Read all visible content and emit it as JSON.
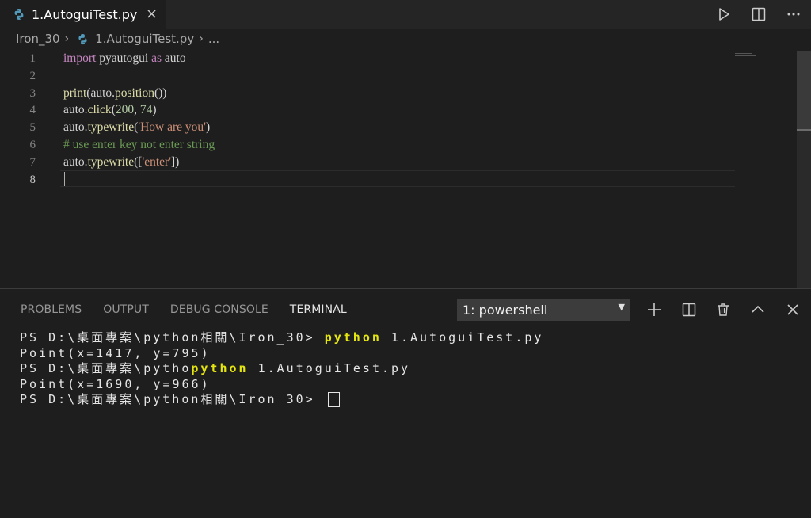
{
  "tab": {
    "label": "1.AutoguiTest.py",
    "close": "×"
  },
  "breadcrumb": {
    "folder": "Iron_30",
    "file": "1.AutoguiTest.py",
    "more": "..."
  },
  "editor": {
    "line_numbers": [
      "1",
      "2",
      "3",
      "4",
      "5",
      "6",
      "7",
      "8"
    ],
    "lines": [
      [
        {
          "t": "import",
          "c": "kw"
        },
        {
          "t": " pyautogui ",
          "c": ""
        },
        {
          "t": "as",
          "c": "kw"
        },
        {
          "t": " auto",
          "c": ""
        }
      ],
      [],
      [
        {
          "t": "print",
          "c": "fn"
        },
        {
          "t": "(auto.",
          "c": ""
        },
        {
          "t": "position",
          "c": "fn"
        },
        {
          "t": "())",
          "c": ""
        }
      ],
      [
        {
          "t": "auto.",
          "c": ""
        },
        {
          "t": "click",
          "c": "fn"
        },
        {
          "t": "(",
          "c": ""
        },
        {
          "t": "200",
          "c": "num"
        },
        {
          "t": ", ",
          "c": ""
        },
        {
          "t": "74",
          "c": "num"
        },
        {
          "t": ")",
          "c": ""
        }
      ],
      [
        {
          "t": "auto.",
          "c": ""
        },
        {
          "t": "typewrite",
          "c": "fn"
        },
        {
          "t": "(",
          "c": ""
        },
        {
          "t": "'How are you'",
          "c": "str"
        },
        {
          "t": ")",
          "c": ""
        }
      ],
      [
        {
          "t": "# use enter key not enter string",
          "c": "cm"
        }
      ],
      [
        {
          "t": "auto.",
          "c": ""
        },
        {
          "t": "typewrite",
          "c": "fn"
        },
        {
          "t": "([",
          "c": ""
        },
        {
          "t": "'enter'",
          "c": "str"
        },
        {
          "t": "])",
          "c": ""
        }
      ],
      []
    ]
  },
  "panel": {
    "tabs": [
      "PROBLEMS",
      "OUTPUT",
      "DEBUG CONSOLE",
      "TERMINAL"
    ],
    "active_tab": "TERMINAL",
    "terminal_select": "1: powershell",
    "terminal_lines": [
      [
        {
          "t": "PS D:\\桌面專案\\python相關\\Iron_30> ",
          "c": ""
        },
        {
          "t": "python",
          "c": "ty"
        },
        {
          "t": " 1.AutoguiTest.py",
          "c": ""
        }
      ],
      [
        {
          "t": "Point(x=1417, y=795)",
          "c": ""
        }
      ],
      [
        {
          "t": "PS D:\\桌面專案\\pytho",
          "c": ""
        },
        {
          "t": "python",
          "c": "ty"
        },
        {
          "t": " 1.AutoguiTest.py",
          "c": ""
        }
      ],
      [
        {
          "t": "Point(x=1690, y=966)",
          "c": ""
        }
      ],
      [
        {
          "t": "PS D:\\桌面專案\\python相關\\Iron_30> ",
          "c": ""
        }
      ]
    ]
  },
  "icons": {
    "run": "run-icon",
    "split": "split-editor-icon",
    "more": "more-icon",
    "add": "add-terminal-icon",
    "split_terminal": "split-terminal-icon",
    "trash": "trash-icon",
    "maximize": "chevron-up-icon",
    "close_panel": "close-icon"
  },
  "colors": {
    "keyword": "#c586c0",
    "function": "#dcdcaa",
    "number": "#b5cea8",
    "string": "#ce9178",
    "comment": "#6a9955",
    "terminal_highlight": "#e5e510"
  }
}
